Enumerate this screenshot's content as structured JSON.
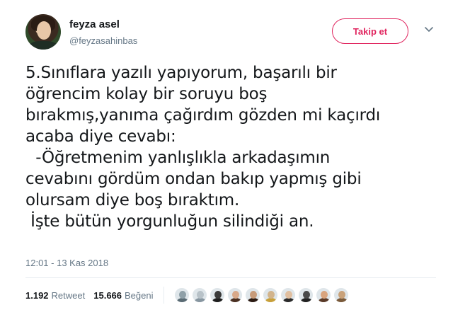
{
  "author": {
    "name": "feyza asel",
    "handle": "@feyzasahinbas"
  },
  "follow_button": {
    "label": "Takip et"
  },
  "tweet": {
    "text": "5.Sınıflara yazılı yapıyorum, başarılı bir\nöğrencim kolay bir soruyu boş\nbırakmış,yanıma çağırdım gözden mi kaçırdı\nacaba diye cevabı:\n  -Öğretmenim yanlışlıkla arkadaşımın\ncevabını gördüm ondan bakıp yapmış gibi\nolursam diye boş bıraktım.\n İşte bütün yorgunluğun silindiği an.",
    "timestamp": "12:01 - 13 Kas 2018"
  },
  "stats": {
    "retweets": {
      "count": "1.192",
      "label": "Retweet"
    },
    "likes": {
      "count": "15.666",
      "label": "Beğeni"
    }
  },
  "colors": {
    "accent": "#e0245e",
    "text": "#14171a",
    "secondary": "#657786",
    "divider": "#e6ecf0"
  },
  "likers": [
    {
      "skin": "#8fa0a8",
      "body": "#5a6b74"
    },
    {
      "skin": "#b8c2c8",
      "body": "#8796a0"
    },
    {
      "skin": "#3a3a3a",
      "body": "#1e1e1e"
    },
    {
      "skin": "#d8a98a",
      "body": "#4a3022"
    },
    {
      "skin": "#c79b7a",
      "body": "#2b1a12"
    },
    {
      "skin": "#d2b48c",
      "body": "#c8a03a"
    },
    {
      "skin": "#e0bfa0",
      "body": "#2a2a2a"
    },
    {
      "skin": "#4a4a4a",
      "body": "#222222"
    },
    {
      "skin": "#d9a47e",
      "body": "#5a3a28"
    },
    {
      "skin": "#c9a27a",
      "body": "#7a5a3a"
    }
  ]
}
